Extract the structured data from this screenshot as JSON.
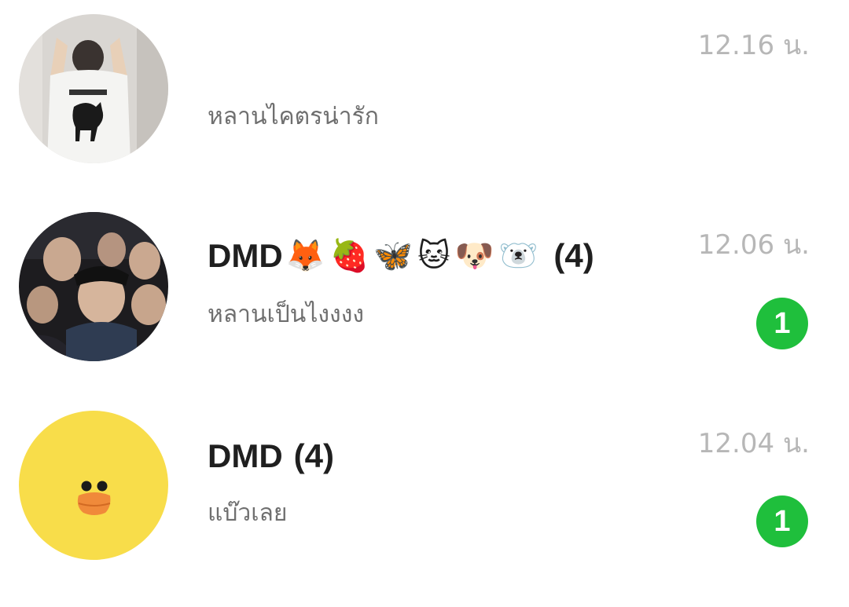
{
  "chats": [
    {
      "name": "",
      "preview": "หลานไคตรน่ารัก",
      "time": "12.16 น.",
      "unread": ""
    },
    {
      "name": "DMD",
      "emojis": [
        "🦊",
        "🍓",
        "🦋",
        "🐱",
        "🐶",
        "🐻‍❄️"
      ],
      "member_count": "(4)",
      "preview": "หลานเป็นไงงงง",
      "time": "12.06 น.",
      "unread": "1"
    },
    {
      "name": "DMD",
      "member_count": "(4)",
      "preview": "แบ๊วเลย",
      "time": "12.04 น.",
      "unread": "1"
    }
  ],
  "colors": {
    "badge": "#1fbf3c",
    "time": "#b7b7b7",
    "preview": "#6f6f6f",
    "name": "#1f1f1f",
    "sally_yellow": "#f8dd4a",
    "sally_beak": "#f08a3a"
  }
}
